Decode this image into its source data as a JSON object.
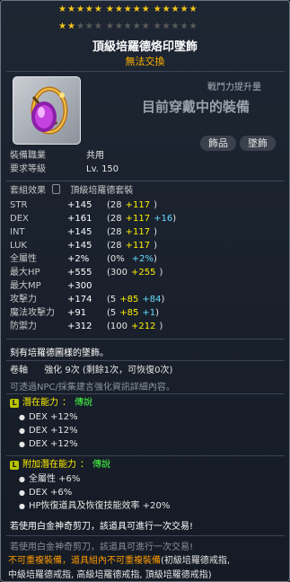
{
  "stars": {
    "filled": 17,
    "total": 30
  },
  "item": {
    "name": "頂級培羅德烙印墜飾",
    "trade": "無法交換",
    "combat_label": "戰鬥力提升量",
    "combat_value": "目前穿戴中的裝備",
    "tags": [
      "飾品",
      "墜飾"
    ],
    "icon": "pendant-icon"
  },
  "req": [
    {
      "label": "裝備職業",
      "value": "共用"
    },
    {
      "label": "要求等級",
      "value": "Lv. 150"
    }
  ],
  "set": {
    "label": "套組效果",
    "name": "頂級培羅德套裝"
  },
  "stats": [
    {
      "name": "STR",
      "total": "+145",
      "base": "(28",
      "bonus": "+117",
      "extra": "",
      "close": ")"
    },
    {
      "name": "DEX",
      "total": "+161",
      "base": "(28",
      "bonus": "+117",
      "extra": "+16",
      "close": ")"
    },
    {
      "name": "INT",
      "total": "+145",
      "base": "(28",
      "bonus": "+117",
      "extra": "",
      "close": ")"
    },
    {
      "name": "LUK",
      "total": "+145",
      "base": "(28",
      "bonus": "+117",
      "extra": "",
      "close": ")"
    },
    {
      "name": "全屬性",
      "total": "+2%",
      "base": "(0%",
      "bonus": "",
      "extra": "+2%",
      "close": ")"
    },
    {
      "name": "最大HP",
      "total": "+555",
      "base": "(300",
      "bonus": "+255",
      "extra": "",
      "close": ")"
    },
    {
      "name": "最大MP",
      "total": "+300",
      "base": "",
      "bonus": "",
      "extra": "",
      "close": ""
    },
    {
      "name": "攻擊力",
      "total": "+174",
      "base": "(5",
      "bonus": "+85",
      "extra": "+84",
      "close": ")"
    },
    {
      "name": "魔法攻擊力",
      "total": "+91",
      "base": "(5",
      "bonus": "+85",
      "extra": "+1",
      "close": ")"
    },
    {
      "name": "防禦力",
      "total": "+312",
      "base": "(100",
      "bonus": "+212",
      "extra": "",
      "close": ")"
    }
  ],
  "desc": "刻有培羅德圖樣的墜飾。",
  "scroll": {
    "label": "卷軸",
    "value": "強化 9次 (剩餘1次，可恢復0次)",
    "hint": "可透過NPC/採集建言強化資訊詳細內容。"
  },
  "potential": {
    "badge": "L",
    "title": "潛在能力",
    "sep": "：",
    "grade": "傳說",
    "lines": [
      "DEX +12%",
      "DEX +12%",
      "DEX +12%"
    ]
  },
  "additional": {
    "badge": "L",
    "title": "附加潛在能力",
    "sep": "：",
    "grade": "傳說",
    "lines": [
      "全屬性 +6%",
      "DEX +6%",
      "HP恢復道具及恢復技能效率 +20%"
    ]
  },
  "scissors": "若使用白金神奇剪刀，該道具可進行一次交易!",
  "scissors_echo": "若使用白金神奇剪刀，該道具可進行一次交易!",
  "restrict": {
    "red": "不可重複裝備，道具組內不可重複裝備",
    "rest": "(初級培羅德戒指,",
    "line2": "中級培羅德戒指, 高級培羅德戒指, 頂級培羅德戒指)"
  },
  "colors": {
    "gold": "#f5c518",
    "bonus": "#ffee00",
    "extra": "#66ddff",
    "grade": "#44ff44",
    "warning": "#ff9a00"
  }
}
